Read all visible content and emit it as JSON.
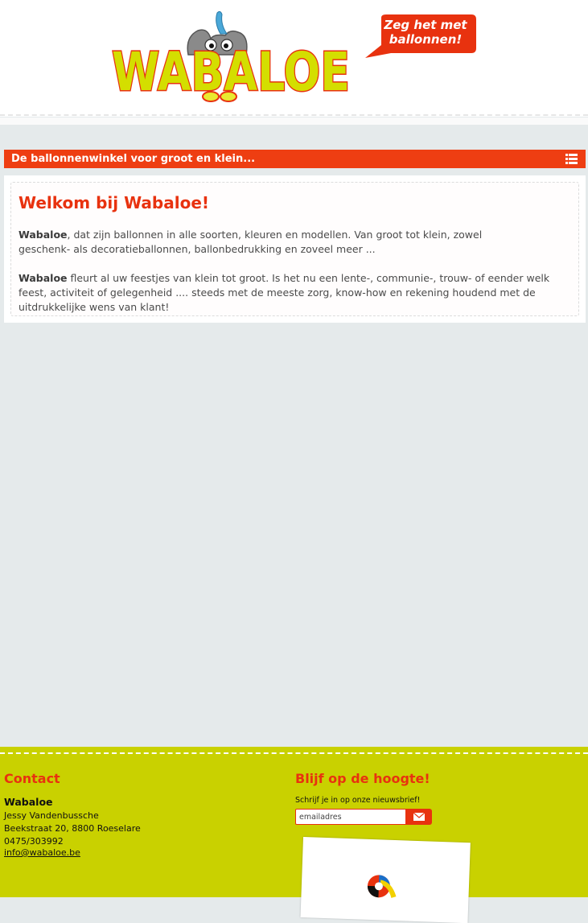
{
  "header": {
    "logo_text": "WABALOE",
    "speech_line1": "Zeg het met",
    "speech_line2": "ballonnen!"
  },
  "banner": {
    "text": "De ballonnenwinkel voor groot en klein...",
    "menu_icon": "list-menu-icon"
  },
  "main": {
    "title": "Welkom bij Wabaloe!",
    "p1_bold": "Wabaloe",
    "p1_rest": ", dat zijn ballonnen in alle soorten, kleuren en modellen. Van groot tot klein, zowel geschenk- als decoratieballonnen, ballonbedrukking en zoveel meer ...",
    "p2_bold": "Wabaloe",
    "p2_rest": " fleurt al uw feestjes van klein tot groot. Is het nu een lente-, communie-, trouw- of eender welk feest, activiteit of gelegenheid .... steeds met de meeste zorg, know-how en rekening houdend met de uitdrukkelijke wens van klant!"
  },
  "footer": {
    "contact": {
      "title": "Contact",
      "name": "Wabaloe",
      "person": "Jessy Vandenbussche",
      "address": "Beekstraat 20, 8800 Roeselare",
      "phone": "0475/303992",
      "email": "info@wabaloe.be"
    },
    "newsletter": {
      "title": "Blijf op de hoogte!",
      "label": "Schrijf je in op onze nieuwsbrief!",
      "placeholder": "emailadres",
      "button_icon": "envelope-icon"
    }
  },
  "colors": {
    "accent": "#e8320f",
    "banner": "#ee3e12",
    "footer": "#c9d100",
    "logo": "#d4de00",
    "background": "#e5eaeb"
  }
}
